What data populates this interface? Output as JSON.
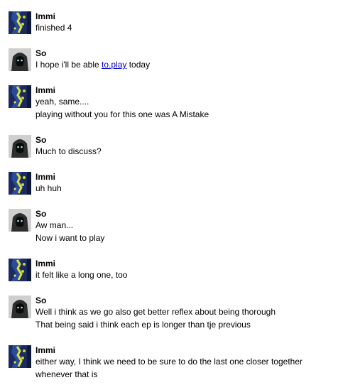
{
  "messages": [
    {
      "author": "Immi",
      "avatar": "immi-avatar",
      "lines": [
        "finished 4"
      ]
    },
    {
      "author": "So",
      "avatar": "so-avatar",
      "before": "I hope i'll be able ",
      "link": "to.play",
      "after": " today"
    },
    {
      "author": "Immi",
      "avatar": "immi-avatar",
      "lines": [
        "yeah, same....",
        "playing without you for this one was A Mistake"
      ]
    },
    {
      "author": "So",
      "avatar": "so-avatar",
      "lines": [
        "Much to discuss?"
      ]
    },
    {
      "author": "Immi",
      "avatar": "immi-avatar",
      "lines": [
        "uh huh"
      ]
    },
    {
      "author": "So",
      "avatar": "so-avatar",
      "lines": [
        "Aw man...",
        "Now i want to play"
      ]
    },
    {
      "author": "Immi",
      "avatar": "immi-avatar",
      "lines": [
        "it felt like a long one, too"
      ]
    },
    {
      "author": "So",
      "avatar": "so-avatar",
      "lines": [
        "Well i think as we go also get better reflex about being thorough",
        "That being said i think each ep is longer than tje previous"
      ]
    },
    {
      "author": "Immi",
      "avatar": "immi-avatar",
      "lines": [
        "either way, I think we need to be sure to do the last one closer together",
        "whenever that is"
      ]
    }
  ]
}
